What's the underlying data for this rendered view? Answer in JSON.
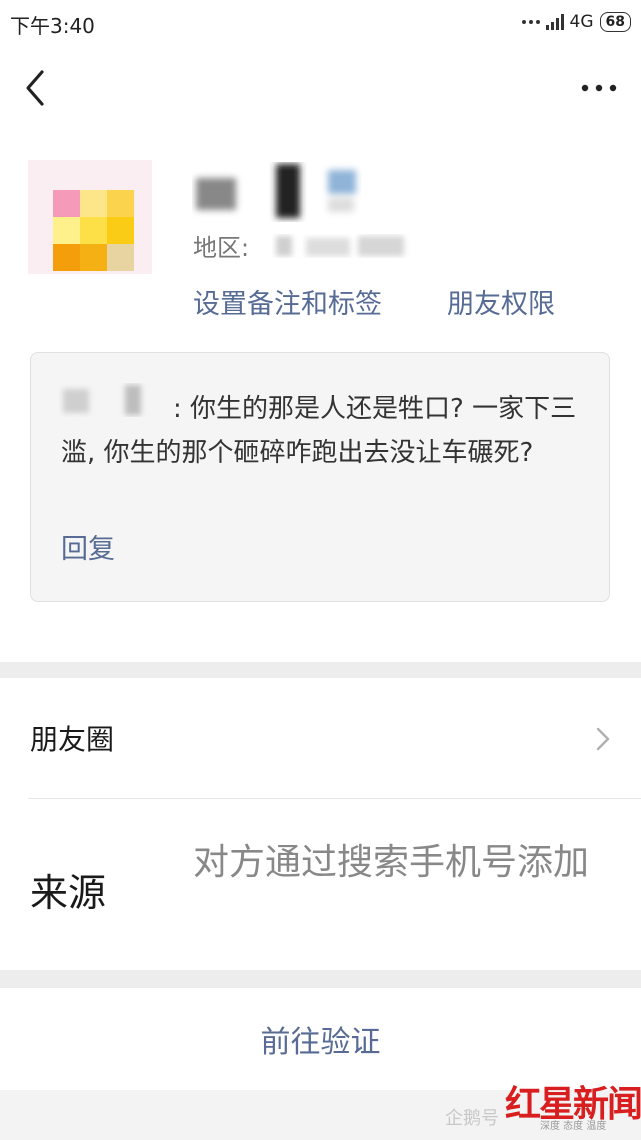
{
  "status_bar": {
    "time": "下午3:40",
    "network": "4G",
    "battery": "68"
  },
  "nav": {
    "back_icon": "chevron-left-icon",
    "more_icon": "more-horizontal-icon"
  },
  "profile": {
    "region_label": "地区:",
    "avatar_colors": [
      "#f59ab8",
      "#fde68a",
      "#fcd34d",
      "#fef08a",
      "#fde047",
      "#facc15",
      "#f59e0b",
      "#f5b014",
      "#e8d4a0"
    ]
  },
  "actions": {
    "set_remark": "设置备注和标签",
    "friend_permission": "朋友权限"
  },
  "message": {
    "text": ": 你生的那是人还是牲口? 一家下三滥, 你生的那个砸碎咋跑出去没让车碾死?",
    "reply": "回复"
  },
  "moments": {
    "label": "朋友圈"
  },
  "source": {
    "label": "来源",
    "value": "对方通过搜索手机号添加"
  },
  "verify": {
    "label": "前往验证"
  },
  "watermark": {
    "left": "企鹅号",
    "brand": "红星新闻",
    "slogan": "深度 态度 温度"
  },
  "colors": {
    "link": "#576b95",
    "gray_bg": "#ededed",
    "brand_red": "#d81e1e"
  }
}
